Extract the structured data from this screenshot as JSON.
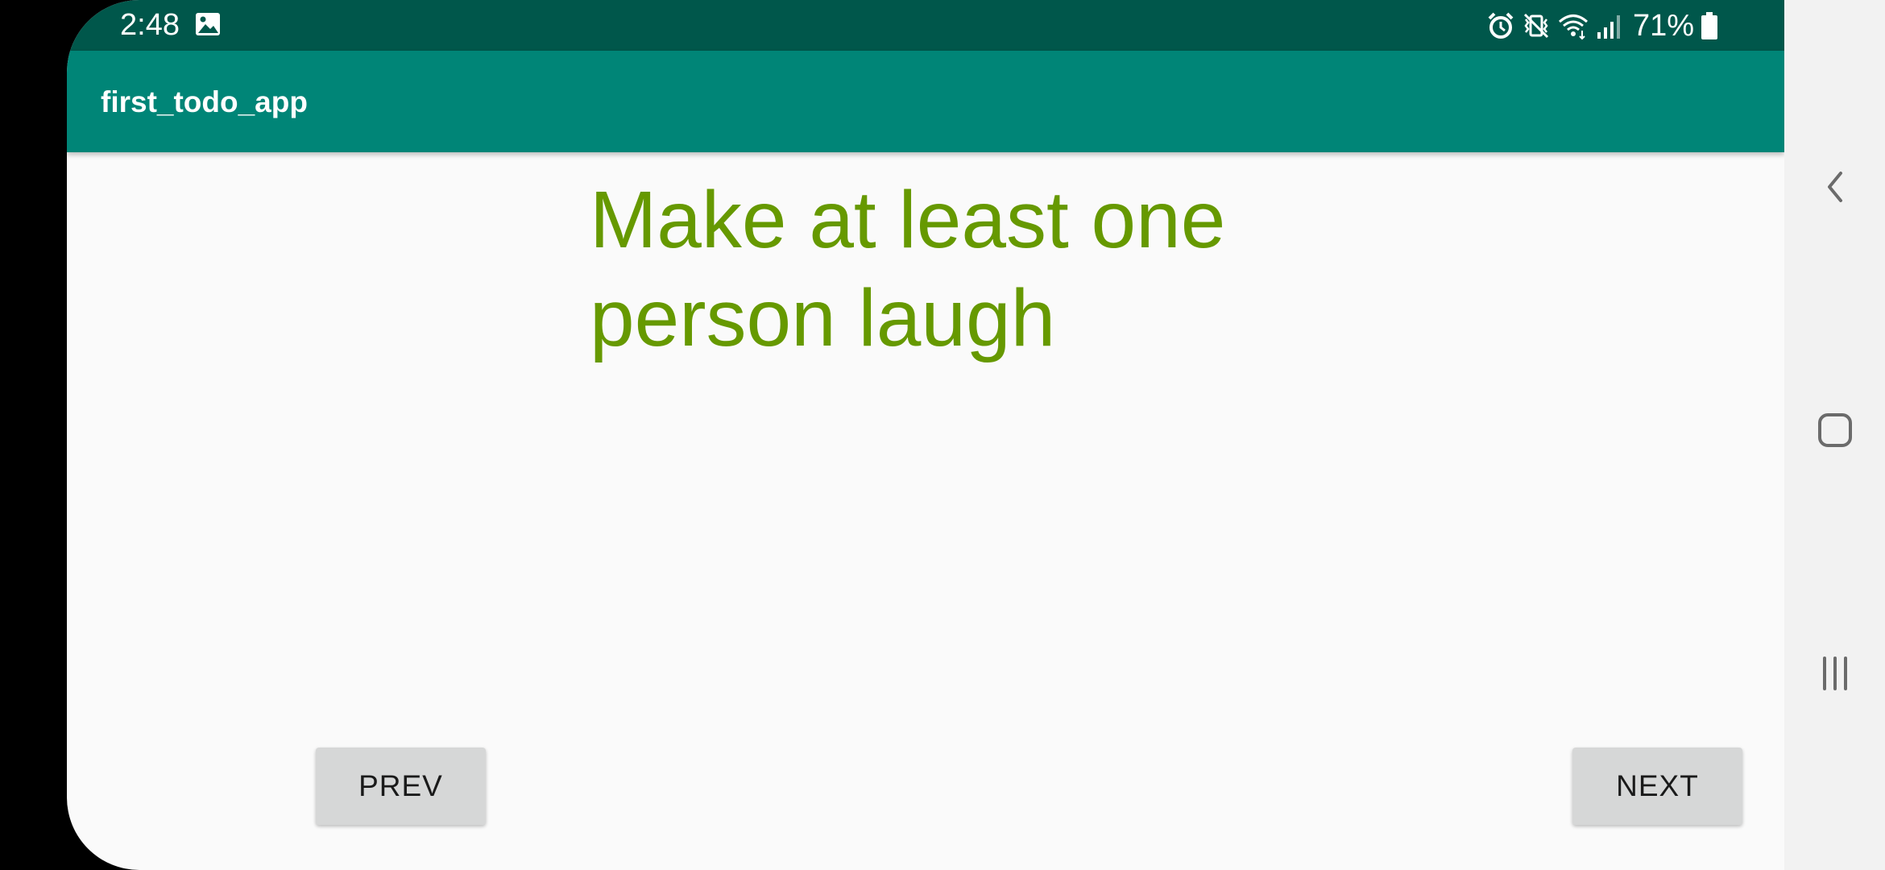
{
  "status_bar": {
    "time": "2:48",
    "battery_percent": "71%",
    "icons": [
      "image-icon",
      "alarm-icon",
      "vibrate-mute-icon",
      "wifi-icon",
      "signal-icon",
      "battery-icon"
    ]
  },
  "app_bar": {
    "title": "first_todo_app"
  },
  "main": {
    "task_text": "Make at least one person laugh",
    "prev_label": "PREV",
    "next_label": "NEXT",
    "text_color": "#669900"
  },
  "nav_bar": {
    "icons": [
      "back-icon",
      "home-icon",
      "recents-icon"
    ]
  },
  "colors": {
    "status_bar": "#00574b",
    "app_bar": "#008577",
    "background": "#fafafa",
    "button": "#d6d7d7"
  }
}
